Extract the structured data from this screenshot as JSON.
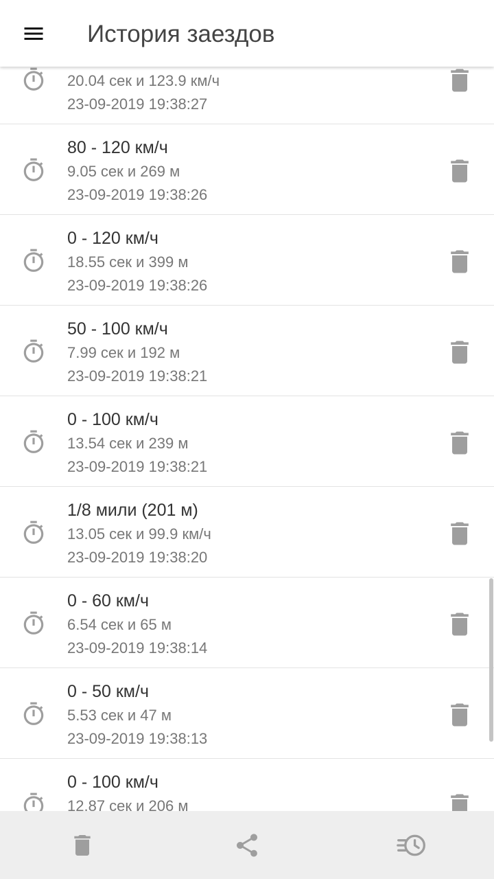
{
  "app_bar": {
    "title": "История заездов",
    "menu_icon": "hamburger-menu-icon"
  },
  "runs": [
    {
      "title": "",
      "detail": "20.04 сек и 123.9 км/ч",
      "date": "23-09-2019 19:38:27"
    },
    {
      "title": "80 - 120 км/ч",
      "detail": "9.05 сек и 269 м",
      "date": "23-09-2019 19:38:26"
    },
    {
      "title": "0 - 120 км/ч",
      "detail": "18.55 сек и 399 м",
      "date": "23-09-2019 19:38:26"
    },
    {
      "title": "50 - 100 км/ч",
      "detail": "7.99 сек и 192 м",
      "date": "23-09-2019 19:38:21"
    },
    {
      "title": "0 - 100 км/ч",
      "detail": "13.54 сек и 239 м",
      "date": "23-09-2019 19:38:21"
    },
    {
      "title": "1/8 мили (201 м)",
      "detail": "13.05 сек и 99.9 км/ч",
      "date": "23-09-2019 19:38:20"
    },
    {
      "title": "0 - 60 км/ч",
      "detail": "6.54 сек и 65 м",
      "date": "23-09-2019 19:38:14"
    },
    {
      "title": "0 - 50 км/ч",
      "detail": "5.53 сек и 47 м",
      "date": "23-09-2019 19:38:13"
    },
    {
      "title": "0 - 100 км/ч",
      "detail": "12.87 сек и 206 м",
      "date": ""
    }
  ],
  "bottom_bar": {
    "delete_icon": "trash-icon",
    "share_icon": "share-icon",
    "history_icon": "history-clock-icon"
  },
  "colors": {
    "icon_gray": "#9e9e9e",
    "title_text": "#333333",
    "secondary_text": "#777777",
    "bottom_bar_bg": "#eeeeee"
  }
}
